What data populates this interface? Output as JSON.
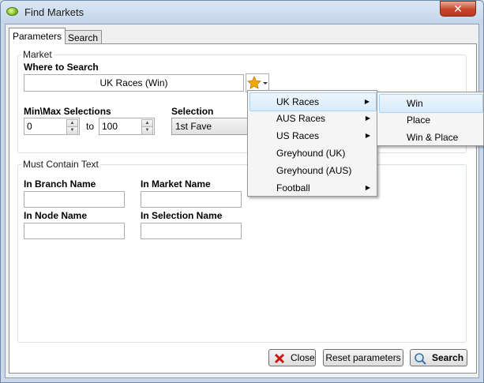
{
  "window": {
    "title": "Find Markets",
    "close_glyph": "✕"
  },
  "tabs": [
    {
      "label": "Parameters",
      "active": true
    },
    {
      "label": "Search",
      "active": false
    }
  ],
  "market": {
    "legend": "Market",
    "where_label": "Where to Search",
    "where_value": "UK Races (Win)",
    "minmax_label": "Min\\Max Selections",
    "min_value": "0",
    "to_label": "to",
    "max_value": "100",
    "selection_label": "Selection",
    "selection_value": "1st Fave"
  },
  "must": {
    "legend": "Must Contain Text",
    "branch_label": "In Branch Name",
    "market_label": "In Market Name",
    "node_label": "In Node Name",
    "selection_label": "In Selection Name"
  },
  "menu": {
    "items": [
      {
        "label": "UK Races",
        "submenu": true
      },
      {
        "label": "AUS Races",
        "submenu": true
      },
      {
        "label": "US Races",
        "submenu": true
      },
      {
        "label": "Greyhound (UK)",
        "submenu": false
      },
      {
        "label": "Greyhound (AUS)",
        "submenu": false
      },
      {
        "label": "Football",
        "submenu": true
      }
    ],
    "submenu_items": [
      "Win",
      "Place",
      "Win & Place"
    ]
  },
  "buttons": {
    "close": "Close",
    "reset": "Reset parameters",
    "search": "Search"
  },
  "colors": {
    "highlight": "#d7ebfb",
    "close_icon": "#d11414",
    "star": "#f5a800"
  }
}
